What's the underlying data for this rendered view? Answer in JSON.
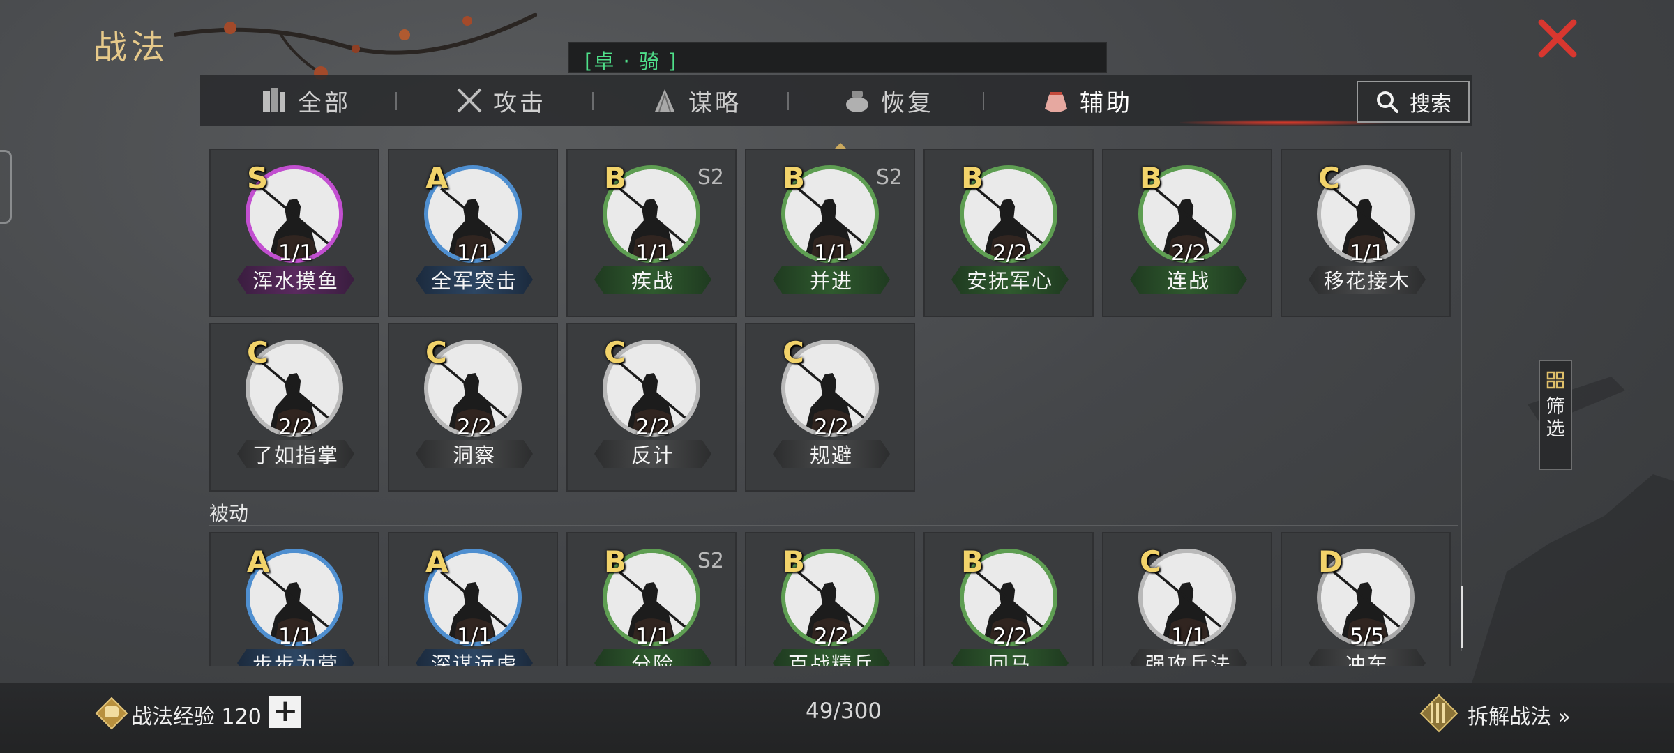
{
  "title": "战法",
  "header": {
    "general": "[卓 · 骑 ]"
  },
  "tabs": [
    {
      "label": "全部",
      "icon": "all-scrolls-icon",
      "active": false
    },
    {
      "label": "攻击",
      "icon": "crossed-swords-icon",
      "active": false
    },
    {
      "label": "谋略",
      "icon": "scroll-fan-icon",
      "active": false
    },
    {
      "label": "恢复",
      "icon": "medicine-pot-icon",
      "active": false
    },
    {
      "label": "辅助",
      "icon": "pouch-icon",
      "active": true
    }
  ],
  "search": {
    "label": "搜索"
  },
  "active_cards": [
    {
      "grade": "S",
      "level": "1/1",
      "name": "浑水摸鱼",
      "season": ""
    },
    {
      "grade": "A",
      "level": "1/1",
      "name": "全军突击",
      "season": ""
    },
    {
      "grade": "B",
      "level": "1/1",
      "name": "疾战",
      "season": "S2"
    },
    {
      "grade": "B",
      "level": "1/1",
      "name": "并进",
      "season": "S2"
    },
    {
      "grade": "B",
      "level": "2/2",
      "name": "安抚军心",
      "season": ""
    },
    {
      "grade": "B",
      "level": "2/2",
      "name": "连战",
      "season": ""
    },
    {
      "grade": "C",
      "level": "1/1",
      "name": "移花接木",
      "season": ""
    },
    {
      "grade": "C",
      "level": "2/2",
      "name": "了如指掌",
      "season": ""
    },
    {
      "grade": "C",
      "level": "2/2",
      "name": "洞察",
      "season": ""
    },
    {
      "grade": "C",
      "level": "2/2",
      "name": "反计",
      "season": ""
    },
    {
      "grade": "C",
      "level": "2/2",
      "name": "规避",
      "season": ""
    }
  ],
  "passive_section": {
    "label": "被动"
  },
  "passive_cards": [
    {
      "grade": "A",
      "level": "1/1",
      "name": "步步为营",
      "season": ""
    },
    {
      "grade": "A",
      "level": "1/1",
      "name": "深谋远虑",
      "season": ""
    },
    {
      "grade": "B",
      "level": "1/1",
      "name": "分险",
      "season": "S2"
    },
    {
      "grade": "B",
      "level": "2/2",
      "name": "百战精兵",
      "season": ""
    },
    {
      "grade": "B",
      "level": "2/2",
      "name": "回马",
      "season": ""
    },
    {
      "grade": "C",
      "level": "1/1",
      "name": "强攻兵法",
      "season": ""
    },
    {
      "grade": "D",
      "level": "5/5",
      "name": "冲车",
      "season": ""
    }
  ],
  "filter": {
    "label": "筛选"
  },
  "bottom": {
    "exp_label": "战法经验 120",
    "plus": "+",
    "count": "49/300",
    "disassemble": "拆解战法 »"
  },
  "colors": {
    "accent_gold": "#e6c98a",
    "close_red": "#d8372f",
    "header_green": "#4fe08a",
    "active_glow": "#e03a2a"
  }
}
